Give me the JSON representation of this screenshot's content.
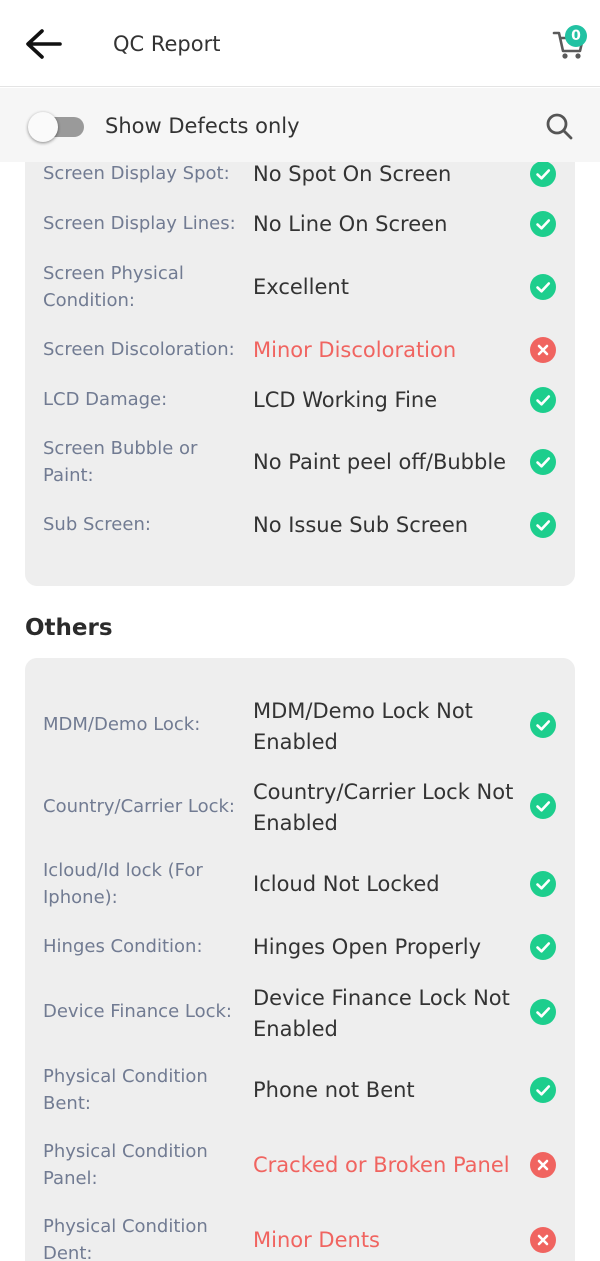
{
  "header": {
    "title": "QC Report",
    "cart_count": "0"
  },
  "filter": {
    "label": "Show Defects only",
    "enabled": false
  },
  "sections": [
    {
      "title": "",
      "items": [
        {
          "label": "Screen Display Spot:",
          "value": "No Spot On Screen",
          "status": "ok"
        },
        {
          "label": "Screen Display Lines:",
          "value": "No Line On Screen",
          "status": "ok"
        },
        {
          "label": "Screen Physical Condition:",
          "value": "Excellent",
          "status": "ok"
        },
        {
          "label": "Screen Discoloration:",
          "value": "Minor Discoloration",
          "status": "defect"
        },
        {
          "label": "LCD Damage:",
          "value": "LCD Working Fine",
          "status": "ok"
        },
        {
          "label": "Screen Bubble or Paint:",
          "value": "No Paint peel off/Bubble",
          "status": "ok"
        },
        {
          "label": "Sub Screen:",
          "value": "No Issue Sub Screen",
          "status": "ok"
        }
      ]
    },
    {
      "title": "Others",
      "items": [
        {
          "label": "MDM/Demo Lock:",
          "value": "MDM/Demo Lock Not Enabled",
          "status": "ok"
        },
        {
          "label": "Country/Carrier Lock:",
          "value": "Country/Carrier Lock Not Enabled",
          "status": "ok"
        },
        {
          "label": "Icloud/Id lock (For Iphone):",
          "value": "Icloud Not Locked",
          "status": "ok"
        },
        {
          "label": "Hinges Condition:",
          "value": "Hinges Open Properly",
          "status": "ok"
        },
        {
          "label": "Device Finance Lock:",
          "value": "Device Finance Lock Not Enabled",
          "status": "ok"
        },
        {
          "label": "Physical Condition Bent:",
          "value": "Phone not Bent",
          "status": "ok"
        },
        {
          "label": "Physical Condition Panel:",
          "value": "Cracked or Broken Panel",
          "status": "defect"
        },
        {
          "label": "Physical Condition Dent:",
          "value": "Minor Dents",
          "status": "defect"
        }
      ]
    }
  ],
  "colors": {
    "ok": "#1dce8d",
    "defect": "#f06460",
    "accent": "#22c2a3"
  }
}
